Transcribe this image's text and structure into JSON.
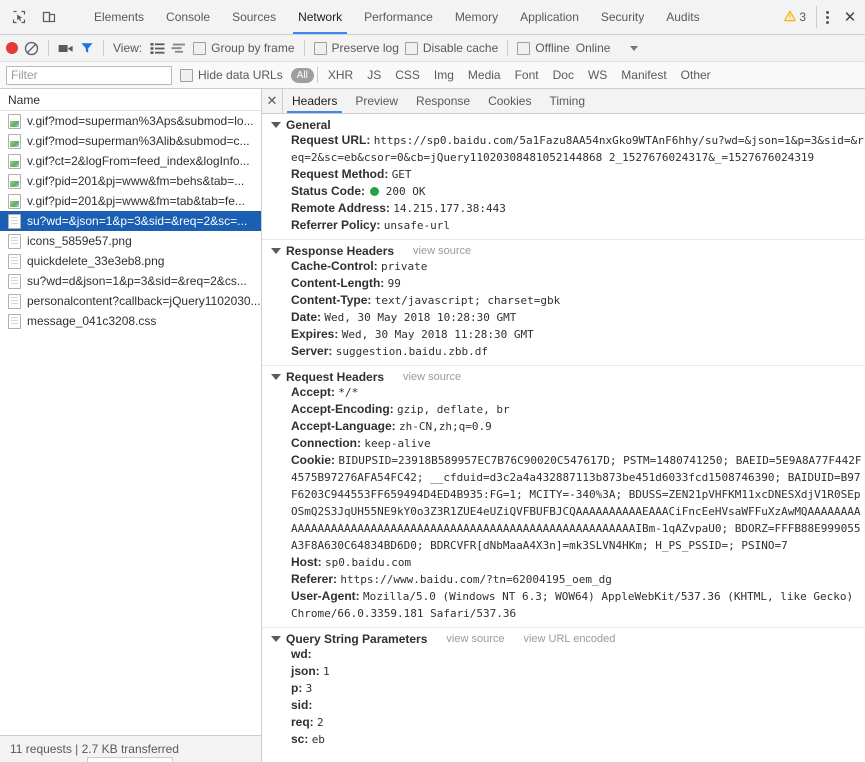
{
  "main_tabs": [
    {
      "label": "Elements",
      "selected": false
    },
    {
      "label": "Console",
      "selected": false
    },
    {
      "label": "Sources",
      "selected": false
    },
    {
      "label": "Network",
      "selected": true
    },
    {
      "label": "Performance",
      "selected": false
    },
    {
      "label": "Memory",
      "selected": false
    },
    {
      "label": "Application",
      "selected": false
    },
    {
      "label": "Security",
      "selected": false
    },
    {
      "label": "Audits",
      "selected": false
    }
  ],
  "warnings": {
    "count": "3"
  },
  "toolbar": {
    "view_label": "View:",
    "group_by_frame": "Group by frame",
    "preserve_log": "Preserve log",
    "disable_cache": "Disable cache",
    "offline": "Offline",
    "online": "Online"
  },
  "filter_bar": {
    "filter_placeholder": "Filter",
    "filter_value": "",
    "hide_data_urls": "Hide data URLs",
    "types": [
      "All",
      "XHR",
      "JS",
      "CSS",
      "Img",
      "Media",
      "Font",
      "Doc",
      "WS",
      "Manifest",
      "Other"
    ],
    "active_type": "All"
  },
  "request_list": {
    "column_header": "Name",
    "rows": [
      {
        "name": "v.gif?mod=superman%3Aps&submod=lo...",
        "icon": "image-file-icon",
        "selected": false
      },
      {
        "name": "v.gif?mod=superman%3Alib&submod=c...",
        "icon": "image-file-icon",
        "selected": false
      },
      {
        "name": "v.gif?ct=2&logFrom=feed_index&logInfo...",
        "icon": "image-file-icon",
        "selected": false
      },
      {
        "name": "v.gif?pid=201&pj=www&fm=behs&tab=...",
        "icon": "image-file-icon",
        "selected": false
      },
      {
        "name": "v.gif?pid=201&pj=www&fm=tab&tab=fe...",
        "icon": "image-file-icon",
        "selected": false
      },
      {
        "name": "su?wd=&json=1&p=3&sid=&req=2&sc=...",
        "icon": "document-file-icon",
        "selected": true
      },
      {
        "name": "icons_5859e57.png",
        "icon": "document-file-icon",
        "selected": false
      },
      {
        "name": "quickdelete_33e3eb8.png",
        "icon": "document-file-icon",
        "selected": false
      },
      {
        "name": "su?wd=d&json=1&p=3&sid=&req=2&cs...",
        "icon": "document-file-icon",
        "selected": false
      },
      {
        "name": "personalcontent?callback=jQuery1102030...",
        "icon": "document-file-icon",
        "selected": false
      },
      {
        "name": "message_041c3208.css",
        "icon": "document-file-icon",
        "selected": false
      }
    ],
    "status_text": "11 requests  |  2.7 KB transferred"
  },
  "detail_tabs": [
    {
      "label": "Headers",
      "selected": true
    },
    {
      "label": "Preview",
      "selected": false
    },
    {
      "label": "Response",
      "selected": false
    },
    {
      "label": "Cookies",
      "selected": false
    },
    {
      "label": "Timing",
      "selected": false
    }
  ],
  "general": {
    "title": "General",
    "request_url_key": "Request URL:",
    "request_url_value": "https://sp0.baidu.com/5a1Fazu8AA54nxGko9WTAnF6hhy/su?wd=&json=1&p=3&sid=&req=2&sc=eb&csor=0&cb=jQuery11020308481052144868 2_1527676024317&_=1527676024319",
    "request_method_key": "Request Method:",
    "request_method_value": "GET",
    "status_code_key": "Status Code:",
    "status_code_value": "200 OK",
    "remote_address_key": "Remote Address:",
    "remote_address_value": "14.215.177.38:443",
    "referrer_policy_key": "Referrer Policy:",
    "referrer_policy_value": "unsafe-url"
  },
  "response_headers": {
    "title": "Response Headers",
    "view_source": "view source",
    "items": [
      {
        "key": "Cache-Control:",
        "value": "private"
      },
      {
        "key": "Content-Length:",
        "value": "99"
      },
      {
        "key": "Content-Type:",
        "value": "text/javascript; charset=gbk"
      },
      {
        "key": "Date:",
        "value": "Wed, 30 May 2018 10:28:30 GMT"
      },
      {
        "key": "Expires:",
        "value": "Wed, 30 May 2018 11:28:30 GMT"
      },
      {
        "key": "Server:",
        "value": "suggestion.baidu.zbb.df"
      }
    ]
  },
  "request_headers": {
    "title": "Request Headers",
    "view_source": "view source",
    "items": [
      {
        "key": "Accept:",
        "value": "*/*"
      },
      {
        "key": "Accept-Encoding:",
        "value": "gzip, deflate, br"
      },
      {
        "key": "Accept-Language:",
        "value": "zh-CN,zh;q=0.9"
      },
      {
        "key": "Connection:",
        "value": "keep-alive"
      },
      {
        "key": "Cookie:",
        "value": "BIDUPSID=23918B589957EC7B76C90020C547617D; PSTM=1480741250; BAEID=5E9A8A77F442F4575B97276AFA54FC42; __cfduid=d3c2a4a432887113b873be451d6033fcd1508746390; BAIDUID=B97F6203C944553FF659494D4ED4B935:FG=1; MCITY=-340%3A; BDUSS=ZEN21pVHFKM11xcDNESXdjV1R0SEpOSmQ2S3JqUH55NE9kY0o3Z3R1ZUE4eUZiQVFBUFBJCQAAAAAAAAAAEAAACiFncEeHVsaWFFuXzAwMQAAAAAAAAAAAAAAAAAAAAAAAAAAAAAAAAAAAAAAAAAAAAAAAAAAAAAAAAAAAAIBm-1qAZvpaU0; BDORZ=FFFB88E999055A3F8A630C64834BD6D0; BDRCVFR[dNbMaaA4X3n]=mk3SLVN4HKm; H_PS_PSSID=; PSINO=7"
      },
      {
        "key": "Host:",
        "value": "sp0.baidu.com"
      },
      {
        "key": "Referer:",
        "value": "https://www.baidu.com/?tn=62004195_oem_dg"
      },
      {
        "key": "User-Agent:",
        "value": "Mozilla/5.0 (Windows NT 6.3; WOW64) AppleWebKit/537.36 (KHTML, like Gecko) Chrome/66.0.3359.181 Safari/537.36"
      }
    ]
  },
  "query_string_parameters": {
    "title": "Query String Parameters",
    "view_source": "view source",
    "view_url_encoded": "view URL encoded",
    "items": [
      {
        "key": "wd:",
        "value": ""
      },
      {
        "key": "json:",
        "value": "1"
      },
      {
        "key": "p:",
        "value": "3"
      },
      {
        "key": "sid:",
        "value": ""
      },
      {
        "key": "req:",
        "value": "2"
      },
      {
        "key": "sc:",
        "value": "eb"
      }
    ]
  },
  "colors": {
    "accent": "#4285f4",
    "selection": "#1a5fb4",
    "record_active": "#e53935",
    "status_ok": "#25a244",
    "warning": "#f5b400"
  }
}
